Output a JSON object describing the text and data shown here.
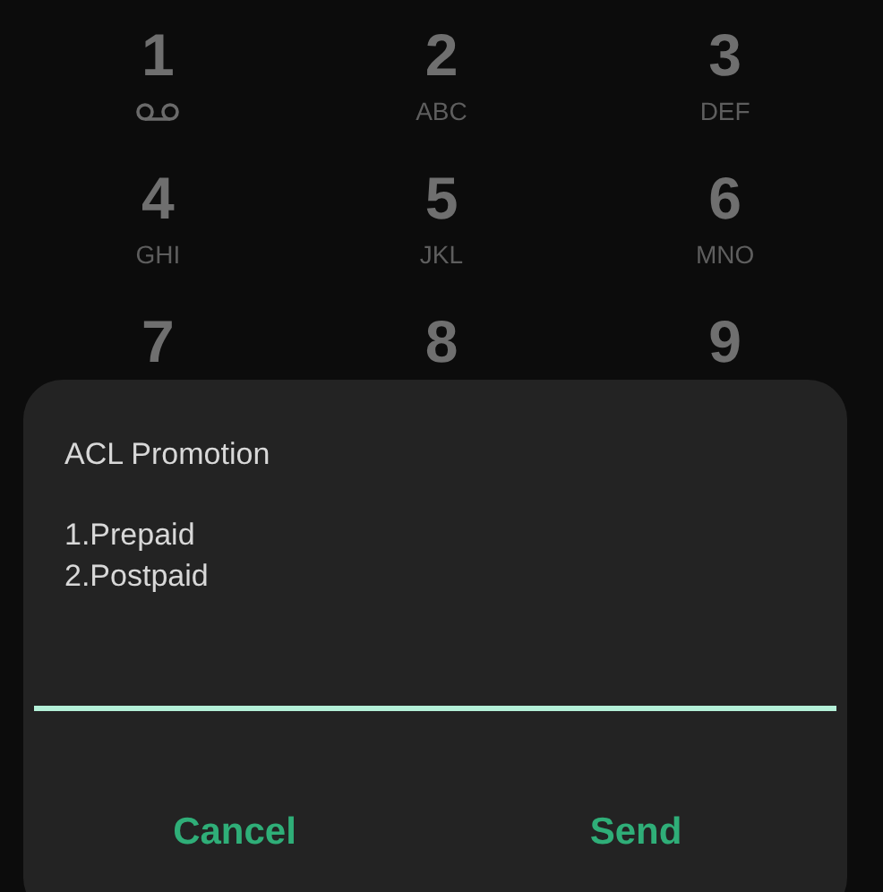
{
  "dialpad": {
    "keys": [
      {
        "digit": "1",
        "kind": "voicemail"
      },
      {
        "digit": "2",
        "kind": "letters",
        "letters": "ABC"
      },
      {
        "digit": "3",
        "kind": "letters",
        "letters": "DEF"
      },
      {
        "digit": "4",
        "kind": "letters",
        "letters": "GHI"
      },
      {
        "digit": "5",
        "kind": "letters",
        "letters": "JKL"
      },
      {
        "digit": "6",
        "kind": "letters",
        "letters": "MNO"
      },
      {
        "digit": "7",
        "kind": "digit"
      },
      {
        "digit": "8",
        "kind": "digit"
      },
      {
        "digit": "9",
        "kind": "digit"
      }
    ]
  },
  "dialog": {
    "title": "ACL Promotion",
    "lines": [
      "1.Prepaid",
      "2.Postpaid"
    ],
    "input": {
      "focused": true
    },
    "buttons": [
      "Cancel",
      "Send"
    ]
  }
}
